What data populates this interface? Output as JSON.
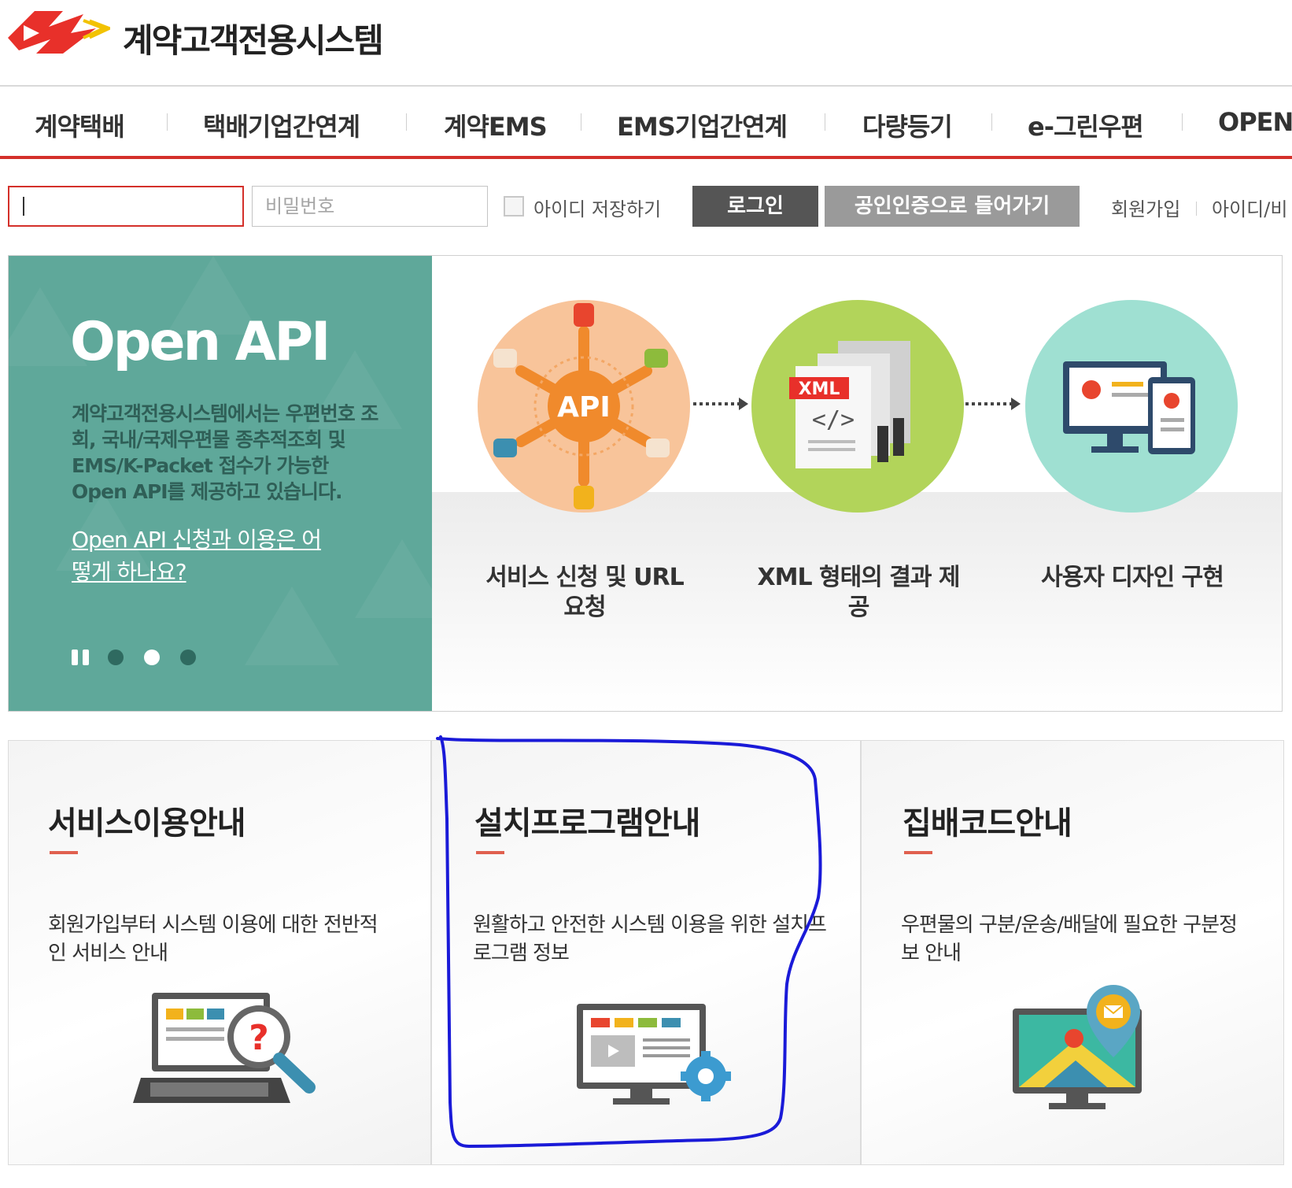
{
  "header": {
    "site_title": "계약고객전용시스템"
  },
  "nav": {
    "items": [
      {
        "label": "계약택배"
      },
      {
        "label": "택배기업간연계"
      },
      {
        "label": "계약EMS"
      },
      {
        "label": "EMS기업간연계"
      },
      {
        "label": "다량등기"
      },
      {
        "label": "e-그린우편"
      },
      {
        "label": "OPEN"
      }
    ]
  },
  "login": {
    "id_value": "",
    "password_placeholder": "비밀번호",
    "remember_label": "아이디 저장하기",
    "login_button": "로그인",
    "cert_button": "공인인증으로 들어가기",
    "join_link": "회원가입",
    "find_link": "아이디/비"
  },
  "banner": {
    "title": "Open API",
    "description": "계약고객전용시스템에서는 우편번호 조회, 국내/국제우편물 종추적조회 및 EMS/K-Packet 접수가 가능한 Open API를 제공하고 있습니다.",
    "link": "Open API 신청과 이용은 어떻게 하나요?",
    "steps": [
      {
        "label": "서비스 신청 및 URL 요청",
        "icon_text": "API"
      },
      {
        "label": "XML 형태의 결과 제공",
        "icon_text": "XML"
      },
      {
        "label": "사용자 디자인 구현"
      }
    ],
    "slides": {
      "count": 3,
      "active": 2
    }
  },
  "cards": [
    {
      "title": "서비스이용안내",
      "description": "회원가입부터 시스템 이용에 대한 전반적인 서비스 안내",
      "icon": "laptop-magnifier-icon"
    },
    {
      "title": "설치프로그램안내",
      "description": "원활하고 안전한 시스템 이용을 위한 설치프로그램 정보",
      "icon": "monitor-gear-icon"
    },
    {
      "title": "집배코드안내",
      "description": "우편물의 구분/운송/배달에 필요한 구분정보 안내",
      "icon": "monitor-map-pin-icon"
    }
  ],
  "colors": {
    "accent_red": "#d4302a",
    "banner_teal": "#5fa89a",
    "highlight_blue": "#1a1ad8"
  }
}
